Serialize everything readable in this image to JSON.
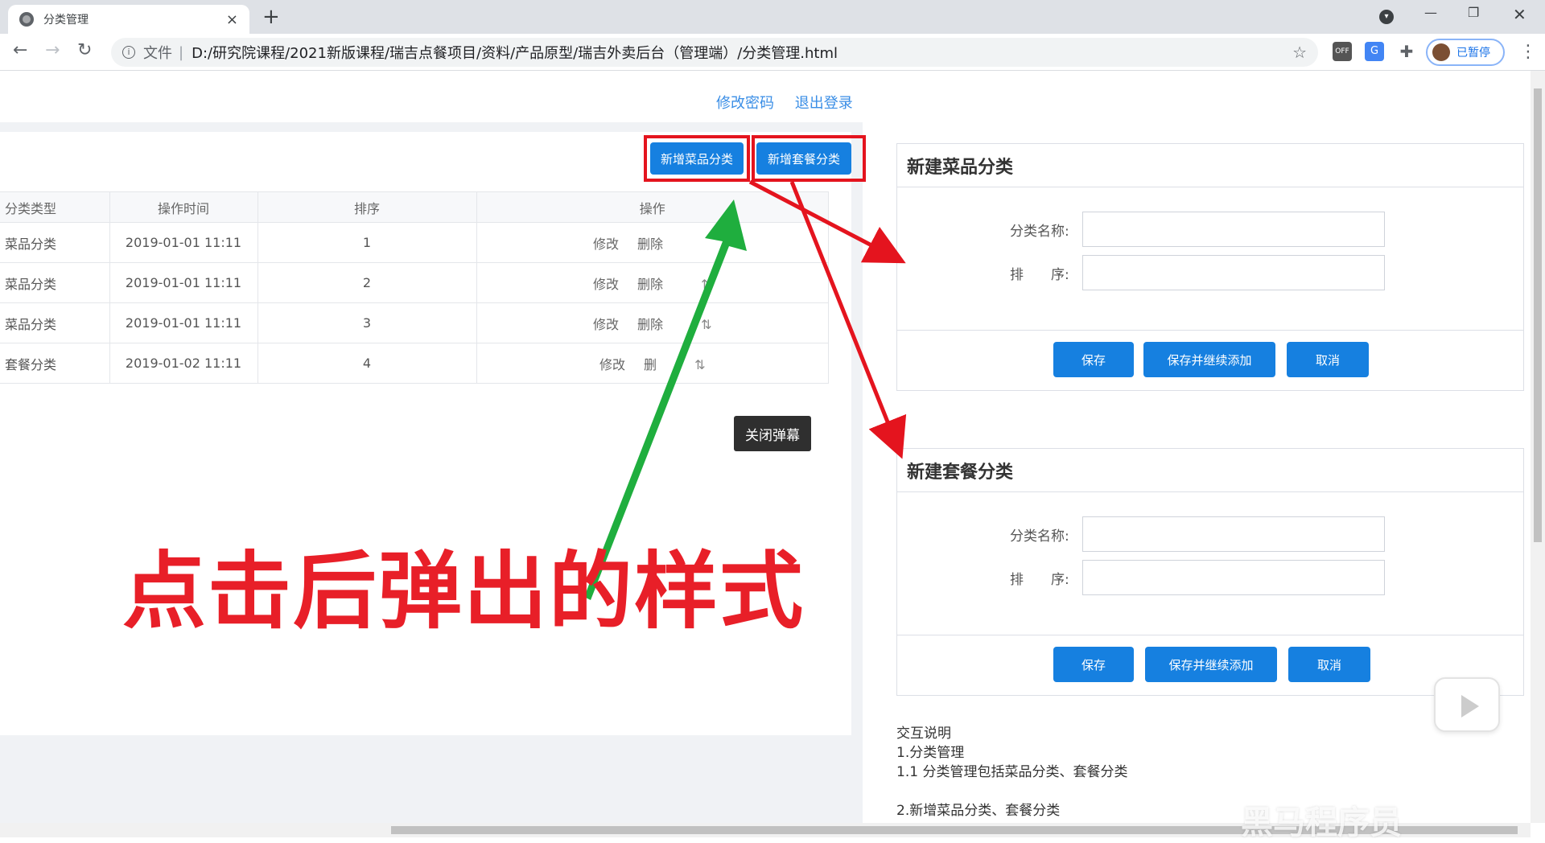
{
  "browser": {
    "tab_title": "分类管理",
    "tab_close": "×",
    "new_tab": "+",
    "address_scheme": "文件",
    "address_sep": "|",
    "address_url": "D:/研究院课程/2021新版课程/瑞吉点餐项目/资料/产品原型/瑞吉外卖后台（管理端）/分类管理.html",
    "profile_label": "已暂停",
    "ext_off_label": "OFF"
  },
  "header": {
    "change_password": "修改密码",
    "logout": "退出登录"
  },
  "actions": {
    "add_dish_category": "新增菜品分类",
    "add_combo_category": "新增套餐分类"
  },
  "table": {
    "headers": [
      "分类类型",
      "操作时间",
      "排序",
      "操作"
    ],
    "rows": [
      {
        "type": "菜品分类",
        "time": "2019-01-01 11:11",
        "sort": "1"
      },
      {
        "type": "菜品分类",
        "time": "2019-01-01 11:11",
        "sort": "2"
      },
      {
        "type": "菜品分类",
        "time": "2019-01-01 11:11",
        "sort": "3"
      },
      {
        "type": "套餐分类",
        "time": "2019-01-02 11:11",
        "sort": "4"
      }
    ],
    "edit_label": "修改",
    "delete_label": "删除",
    "row4_delete_partial": "删"
  },
  "close_danmu": "关闭弹幕",
  "annotation_text": "点击后弹出的样式",
  "dish_form": {
    "title": "新建菜品分类",
    "name_label": "分类名称:",
    "sort_label": "排　　序:",
    "save": "保存",
    "save_continue": "保存并继续添加",
    "cancel": "取消"
  },
  "combo_form": {
    "title": "新建套餐分类",
    "name_label": "分类名称:",
    "sort_label": "排　　序:",
    "save": "保存",
    "save_continue": "保存并继续添加",
    "cancel": "取消"
  },
  "notes": {
    "title": "交互说明",
    "line1": "1.分类管理",
    "line2": "1.1 分类管理包括菜品分类、套餐分类",
    "line3": "2.新增菜品分类、套餐分类"
  },
  "watermark": "黑马程序员",
  "colors": {
    "accent_blue": "#1680e0",
    "link_blue": "#3a8ee6",
    "annotation_red": "#e81f28",
    "arrow_green": "#1fae3e"
  }
}
